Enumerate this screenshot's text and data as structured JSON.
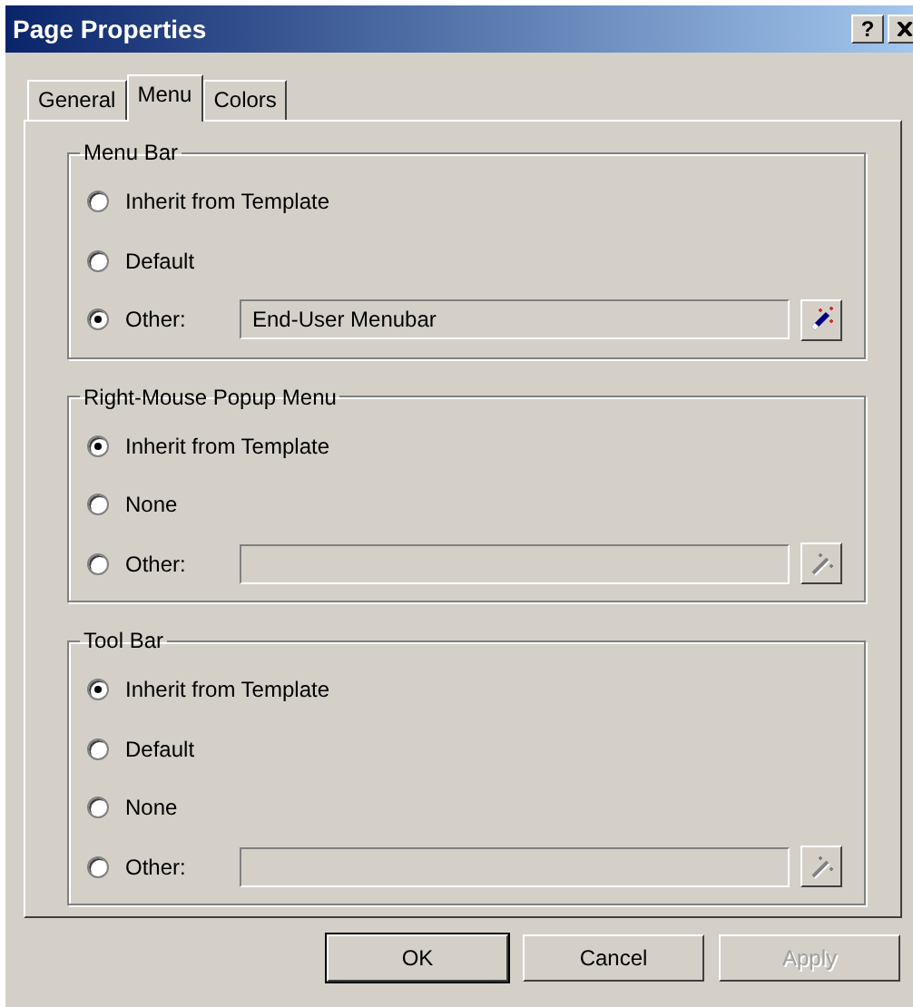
{
  "window": {
    "title": "Page Properties",
    "help": "?"
  },
  "tabs": [
    {
      "label": "General",
      "selected": false
    },
    {
      "label": "Menu",
      "selected": true
    },
    {
      "label": "Colors",
      "selected": false
    }
  ],
  "groups": [
    {
      "title": "Menu Bar",
      "options": [
        {
          "kind": "radio",
          "label": "Inherit from Template",
          "selected": false
        },
        {
          "kind": "radio",
          "label": "Default",
          "selected": false
        },
        {
          "kind": "other",
          "label": "Other:",
          "selected": true,
          "field": {
            "value": "End-User Menubar",
            "disabled": false
          }
        }
      ]
    },
    {
      "title": "Right-Mouse Popup Menu",
      "options": [
        {
          "kind": "radio",
          "label": "Inherit from Template",
          "selected": true
        },
        {
          "kind": "radio",
          "label": "None",
          "selected": false
        },
        {
          "kind": "other",
          "label": "Other:",
          "selected": false,
          "field": {
            "disabled": true
          }
        }
      ]
    },
    {
      "title": "Tool Bar",
      "options": [
        {
          "kind": "radio",
          "label": "Inherit from Template",
          "selected": true
        },
        {
          "kind": "radio",
          "label": "Default",
          "selected": false
        },
        {
          "kind": "radio",
          "label": "None",
          "selected": false
        },
        {
          "kind": "other",
          "label": "Other:",
          "selected": false,
          "field": {
            "disabled": true
          }
        }
      ]
    }
  ],
  "buttons": [
    {
      "label": "OK",
      "default": true,
      "disabled": false
    },
    {
      "label": "Cancel",
      "default": false,
      "disabled": false
    },
    {
      "label": "Apply",
      "default": false,
      "disabled": true
    }
  ]
}
